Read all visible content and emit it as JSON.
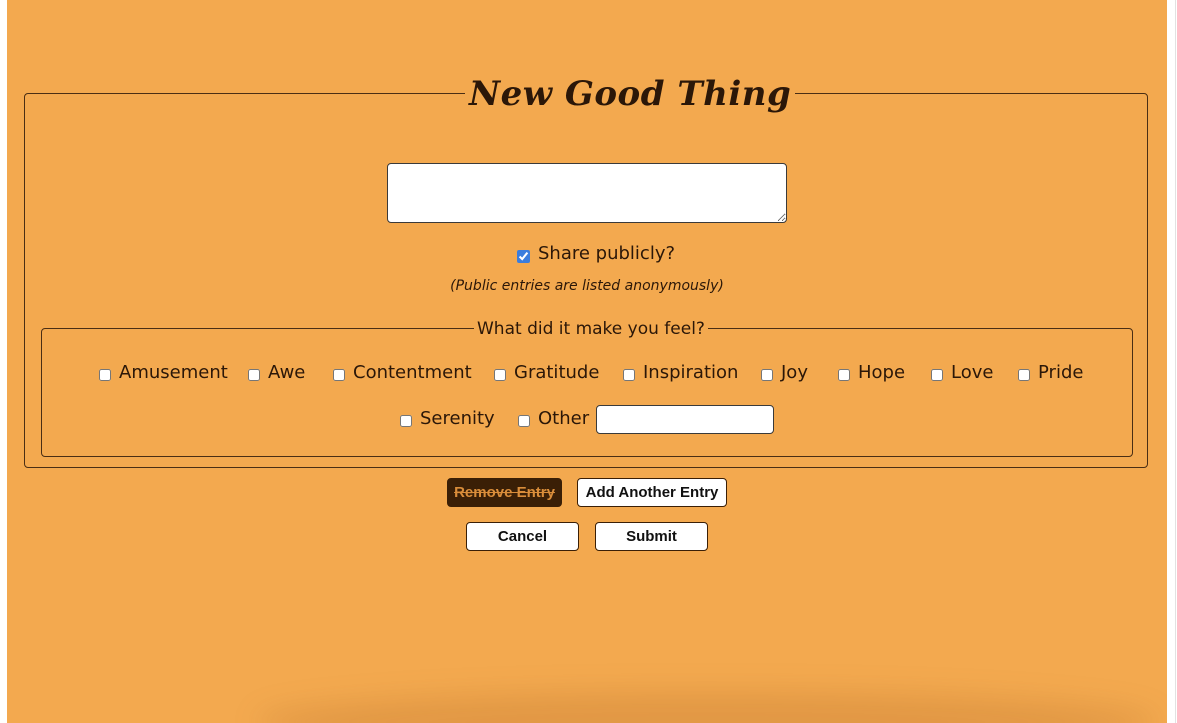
{
  "form": {
    "title": "New Good Thing",
    "entry_text": "",
    "share": {
      "label": "Share publicly?",
      "checked": true,
      "note": "(Public entries are listed anonymously)"
    },
    "feelings": {
      "legend": "What did it make you feel?",
      "options": [
        {
          "label": "Amusement",
          "checked": false
        },
        {
          "label": "Awe",
          "checked": false
        },
        {
          "label": "Contentment",
          "checked": false
        },
        {
          "label": "Gratitude",
          "checked": false
        },
        {
          "label": "Inspiration",
          "checked": false
        },
        {
          "label": "Joy",
          "checked": false
        },
        {
          "label": "Hope",
          "checked": false
        },
        {
          "label": "Love",
          "checked": false
        },
        {
          "label": "Pride",
          "checked": false
        },
        {
          "label": "Serenity",
          "checked": false
        },
        {
          "label": "Other",
          "checked": false
        }
      ],
      "other_value": ""
    }
  },
  "buttons": {
    "remove_entry": "Remove Entry",
    "add_another_entry": "Add Another Entry",
    "cancel": "Cancel",
    "submit": "Submit"
  },
  "colors": {
    "background": "#f3a94f",
    "text_dark": "#2b1708",
    "remove_button_bg": "#3a1f06",
    "remove_button_text": "#d98d3a",
    "checkbox_accent": "#3b7ddd"
  }
}
